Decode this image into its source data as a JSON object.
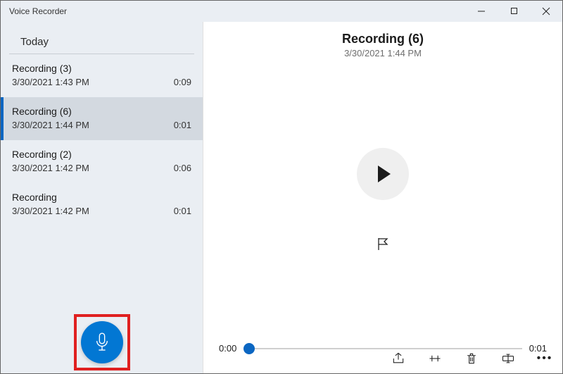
{
  "window": {
    "title": "Voice Recorder"
  },
  "sidebar": {
    "section_label": "Today",
    "items": [
      {
        "name": "Recording (3)",
        "date": "3/30/2021 1:43 PM",
        "duration": "0:09",
        "selected": false
      },
      {
        "name": "Recording (6)",
        "date": "3/30/2021 1:44 PM",
        "duration": "0:01",
        "selected": true
      },
      {
        "name": "Recording (2)",
        "date": "3/30/2021 1:42 PM",
        "duration": "0:06",
        "selected": false
      },
      {
        "name": "Recording",
        "date": "3/30/2021 1:42 PM",
        "duration": "0:01",
        "selected": false
      }
    ]
  },
  "main": {
    "title": "Recording (6)",
    "date": "3/30/2021 1:44 PM",
    "time_start": "0:00",
    "time_end": "0:01"
  },
  "colors": {
    "accent": "#0a66c2",
    "record_button": "#0277d3",
    "highlight_border": "#e02020"
  }
}
